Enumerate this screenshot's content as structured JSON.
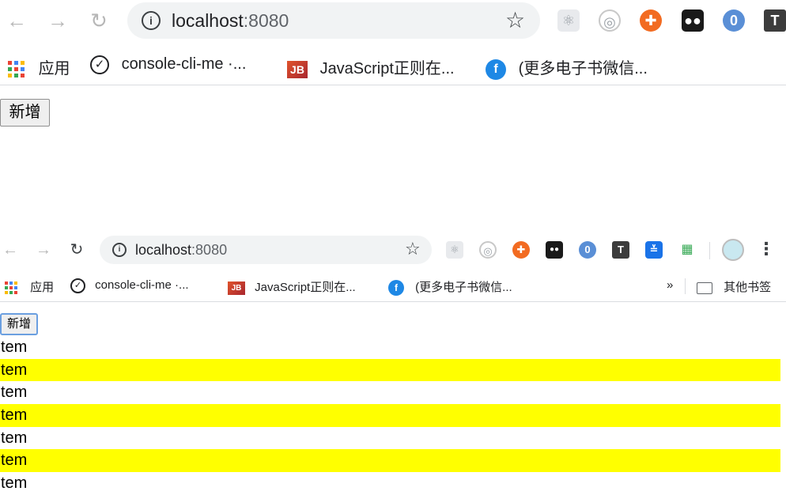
{
  "window1": {
    "url_host": "localhost",
    "url_port": ":8080",
    "bookmarks": [
      {
        "label": "应用",
        "icon": "apps-grid-icon"
      },
      {
        "label": "console-cli-me ·...",
        "icon": "check-circle-icon"
      },
      {
        "label": "JavaScript正则在...",
        "icon": "jb-logo-icon"
      },
      {
        "label": "(更多电子书微信...",
        "icon": "blue-f-icon"
      }
    ],
    "add_button": "新增"
  },
  "window2": {
    "url_host": "localhost",
    "url_port": ":8080",
    "bookmarks": [
      {
        "label": "应用",
        "icon": "apps-grid-icon"
      },
      {
        "label": "console-cli-me ·...",
        "icon": "check-circle-icon"
      },
      {
        "label": "JavaScript正则在...",
        "icon": "jb-logo-icon"
      },
      {
        "label": "(更多电子书微信...",
        "icon": "blue-f-icon"
      }
    ],
    "overflow": "»",
    "other_bookmarks": "其他书签",
    "add_button": "新增",
    "items": [
      {
        "text": "tem",
        "highlighted": false
      },
      {
        "text": "tem",
        "highlighted": true
      },
      {
        "text": "tem",
        "highlighted": false
      },
      {
        "text": "tem",
        "highlighted": true
      },
      {
        "text": "tem",
        "highlighted": false
      },
      {
        "text": "tem",
        "highlighted": true
      },
      {
        "text": "tem",
        "highlighted": false
      }
    ]
  },
  "colors": {
    "highlight": "#ffff00",
    "omnibox": "#f1f3f4",
    "focus_ring": "#6b9fe0"
  }
}
